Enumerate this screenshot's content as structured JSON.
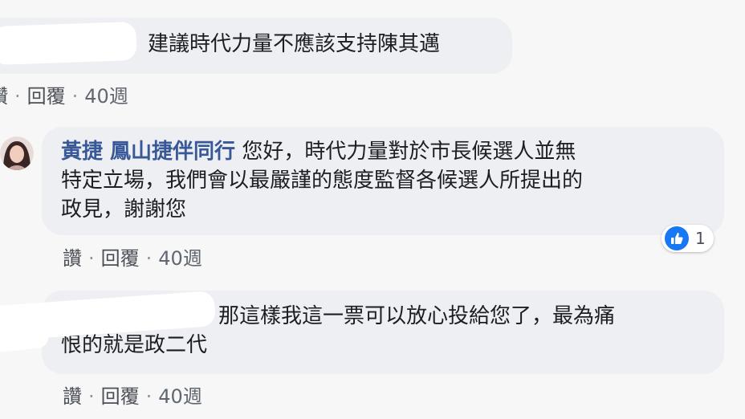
{
  "comments": [
    {
      "author": "",
      "text": "建議時代力量不應該支持陳其邁",
      "actions": {
        "like": "讚",
        "reply": "回覆",
        "time": "40週"
      }
    },
    {
      "author": "黃捷 鳳山捷伴同行",
      "text_lines": [
        "您好，時代力量對於市長候選人並無",
        "特定立場，我們會以最嚴謹的態度監督各候選人所提出的",
        "政見，謝謝您"
      ],
      "actions": {
        "like": "讚",
        "reply": "回覆",
        "time": "40週"
      },
      "reaction": {
        "icon": "thumbs-up-icon",
        "count": "1",
        "color": "#1877f2"
      }
    },
    {
      "author": "",
      "text_lines": [
        "那這樣我這一票可以放心投給您了，最為痛",
        "恨的就是政二代"
      ],
      "actions": {
        "like": "讚",
        "reply": "回覆",
        "time": "40週"
      }
    }
  ],
  "colors": {
    "author_name": "#385898",
    "bubble": "#edeff2",
    "like_blue": "#1877f2"
  }
}
